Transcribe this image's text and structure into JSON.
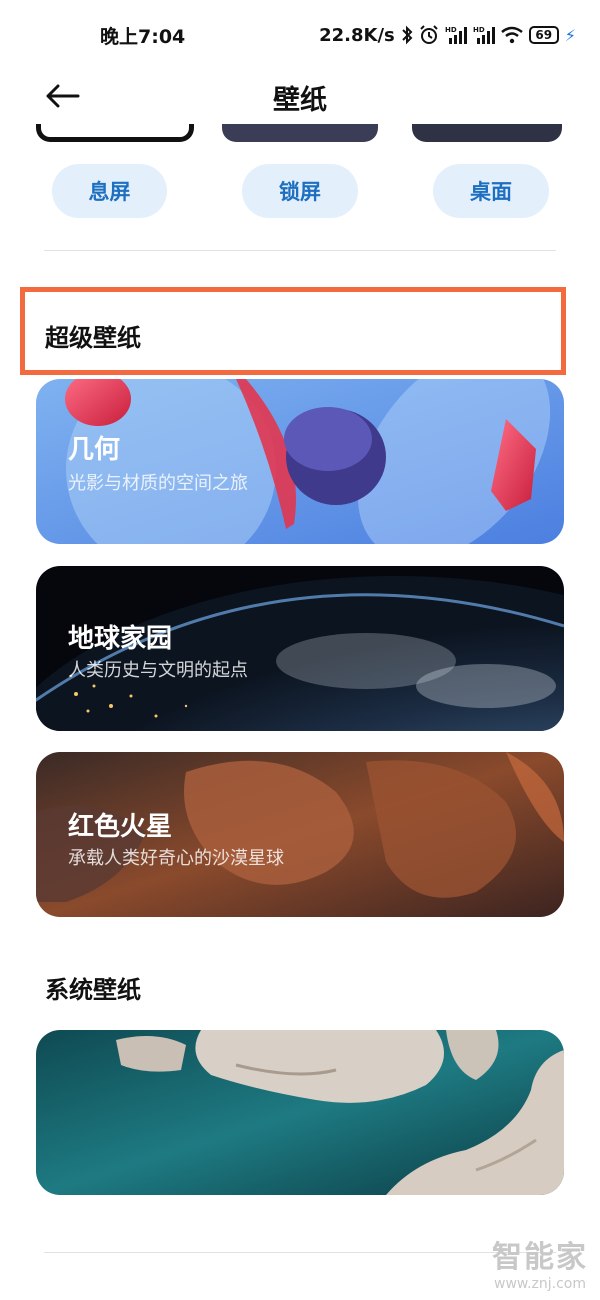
{
  "status": {
    "time": "晚上7:04",
    "net_speed": "22.8K/s",
    "battery": "69",
    "icons": [
      "bluetooth-icon",
      "alarm-icon",
      "signal-hd-icon",
      "signal-hd-icon",
      "wifi-icon",
      "battery-icon",
      "charging-icon"
    ]
  },
  "header": {
    "title": "壁纸",
    "back_icon": "back-arrow-icon"
  },
  "modes": [
    "息屏",
    "锁屏",
    "桌面"
  ],
  "super_section": {
    "title": "超级壁纸",
    "cards": [
      {
        "title": "几何",
        "subtitle": "光影与材质的空间之旅"
      },
      {
        "title": "地球家园",
        "subtitle": "人类历史与文明的起点"
      },
      {
        "title": "红色火星",
        "subtitle": "承载人类好奇心的沙漠星球"
      }
    ]
  },
  "system_section": {
    "title": "系统壁纸"
  },
  "watermark": {
    "logo": "智能家",
    "url": "www.znj.com"
  },
  "colors": {
    "accent": "#1f6fc0",
    "pill_bg": "#e3f0fb",
    "highlight": "#f26a3e"
  }
}
